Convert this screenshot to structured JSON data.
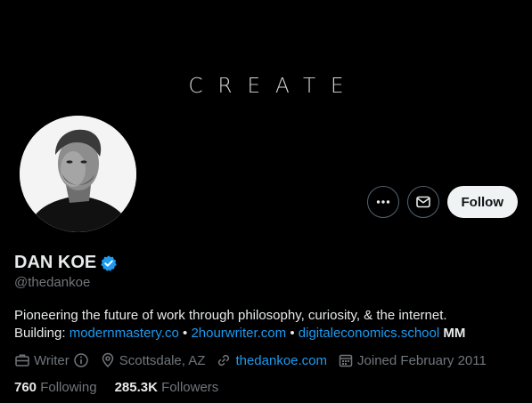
{
  "banner": {
    "text": "CREATE"
  },
  "profile": {
    "name": "DAN KOE",
    "handle": "@thedankoe",
    "verified": true,
    "verified_color": "#1d9bf0"
  },
  "actions": {
    "more_icon": "more-horizontal-icon",
    "message_icon": "envelope-icon",
    "follow_label": "Follow"
  },
  "bio": {
    "line1": "Pioneering the future of work through philosophy, curiosity, & the internet.",
    "building_label": "Building:",
    "links": [
      "modernmastery.co",
      "2hourwriter.com",
      "digitaleconomics.school"
    ],
    "separator": "•",
    "suffix": "MM"
  },
  "meta": {
    "category": "Writer",
    "location": "Scottsdale, AZ",
    "website": "thedankoe.com",
    "joined": "Joined February 2011"
  },
  "stats": {
    "following_count": "760",
    "following_label": "Following",
    "followers_count": "285.3K",
    "followers_label": "Followers"
  },
  "colors": {
    "background": "#000000",
    "link": "#1d9bf0",
    "muted": "#71767b",
    "text": "#e7e9ea"
  }
}
